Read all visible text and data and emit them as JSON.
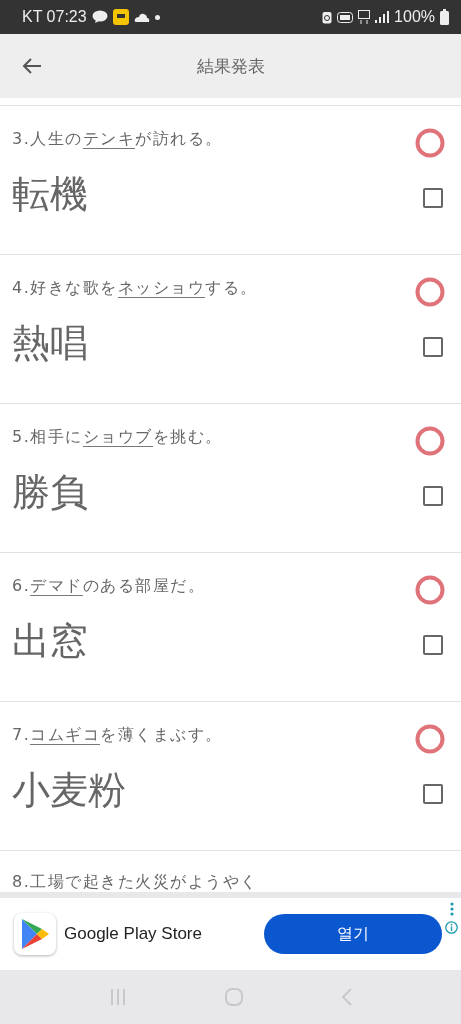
{
  "status_bar": {
    "carrier_time": "KT 07:23",
    "battery": "100%"
  },
  "header": {
    "title": "結果発表"
  },
  "questions": [
    {
      "number": "3.",
      "before": "人生の",
      "underlined": "テンキ",
      "after": "が訪れる。",
      "answer": "転機",
      "correct": true,
      "checked": false
    },
    {
      "number": "4.",
      "before": "好きな歌を",
      "underlined": "ネッショウ",
      "after": "する。",
      "answer": "熱唱",
      "correct": true,
      "checked": false
    },
    {
      "number": "5.",
      "before": "相手に",
      "underlined": "ショウブ",
      "after": "を挑む。",
      "answer": "勝負",
      "correct": true,
      "checked": false
    },
    {
      "number": "6.",
      "underlined": "デマド",
      "after": "のある部屋だ。",
      "answer": "出窓",
      "correct": true,
      "checked": false
    },
    {
      "number": "7.",
      "underlined": "コムギコ",
      "after": "を薄くまぶす。",
      "answer": "小麦粉",
      "correct": true,
      "checked": false
    }
  ],
  "partial_question": "8.工場で起きた火災がようやく",
  "ad": {
    "app_name": "Google Play Store",
    "button": "열기"
  }
}
